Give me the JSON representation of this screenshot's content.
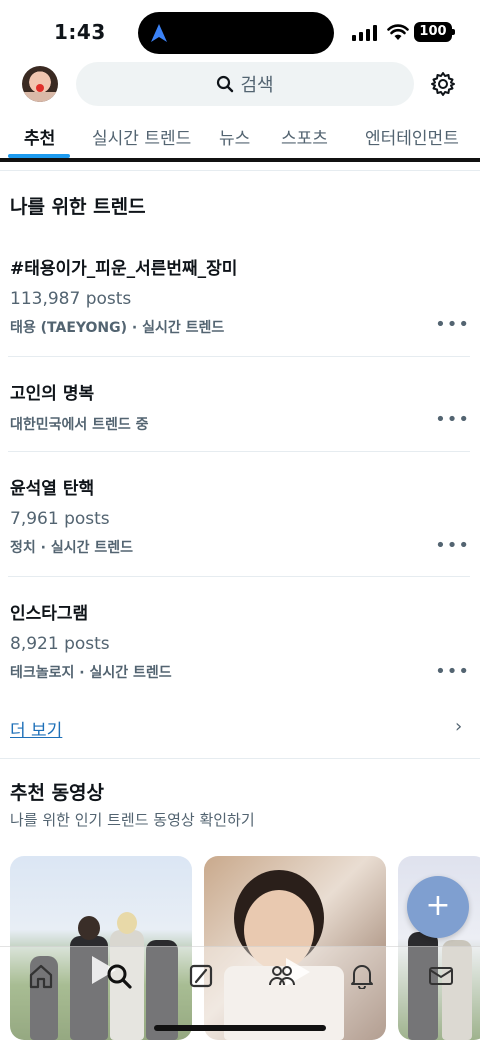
{
  "status_bar": {
    "time": "1:43",
    "battery": "100"
  },
  "header": {
    "search_placeholder": "검색",
    "tabs": [
      {
        "label": "추천"
      },
      {
        "label": "실시간 트렌드"
      },
      {
        "label": "뉴스"
      },
      {
        "label": "스포츠"
      },
      {
        "label": "엔터테인먼트"
      }
    ]
  },
  "trends_section": {
    "title": "나를 위한 트렌드",
    "items": [
      {
        "name": "#태용이가_피운_서른번째_장미",
        "count": "113,987 posts",
        "meta": "태용 (TAEYONG) · 실시간 트렌드"
      },
      {
        "name": "고인의 명복",
        "count": "",
        "meta": "대한민국에서 트렌드 중"
      },
      {
        "name": "윤석열 탄핵",
        "count": "7,961 posts",
        "meta": "정치 · 실시간 트렌드"
      },
      {
        "name": "인스타그램",
        "count": "8,921 posts",
        "meta": "테크놀로지 · 실시간 트렌드"
      }
    ],
    "more_dots": "•••",
    "see_more": "더 보기",
    "chevron": "›"
  },
  "videos_section": {
    "title": "추천 동영상",
    "subtitle": "나를 위한 인기 트렌드 동영상 확인하기"
  },
  "fab": {
    "label": "+"
  },
  "colors": {
    "accent": "#1d9bf0",
    "link": "#1d6fb8",
    "secondary_text": "#536471",
    "fab": "#7f9fd0"
  },
  "nav_icons": [
    "home-icon",
    "search-icon",
    "grok-icon",
    "communities-icon",
    "notifications-icon",
    "messages-icon"
  ]
}
